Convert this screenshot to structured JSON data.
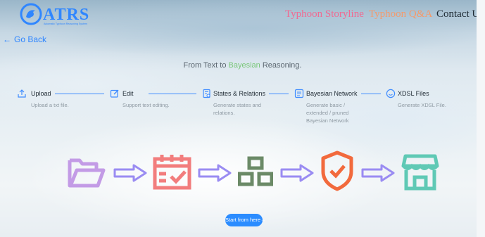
{
  "header": {
    "logo_text": "ATRS",
    "logo_subtitle": "Automatic Typhoon Reasoning System",
    "nav": {
      "storyline": "Typhoon Storyline",
      "qa": "Typhoon Q&A",
      "contact": "Contact Us"
    }
  },
  "go_back": "Go Back",
  "headline": {
    "prefix": "From Text to ",
    "highlight": "Bayesian",
    "suffix": " Reasoning."
  },
  "steps": [
    {
      "title": "Upload",
      "desc": "Upload a txt file.",
      "icon": "upload-icon"
    },
    {
      "title": "Edit",
      "desc": "Support text editing.",
      "icon": "edit-icon"
    },
    {
      "title": "States & Relations",
      "desc": "Generate states and relations.",
      "icon": "document-search-icon"
    },
    {
      "title": "Bayesian Network",
      "desc": "Generate basic / extended / pruned Bayesian Network",
      "icon": "list-icon"
    },
    {
      "title": "XDSL Files",
      "desc": "Generate XDSL File.",
      "icon": "smile-icon"
    }
  ],
  "flow_icons": [
    "folder-icon",
    "calendar-check-icon",
    "blocks-icon",
    "shield-check-icon",
    "store-icon"
  ],
  "start_button": "Start from here→",
  "colors": {
    "accent_blue": "#2b8cff",
    "storyline_pink": "#f06a92",
    "qa_orange": "#f49a6c",
    "highlight_green": "#7ac77a",
    "folder_purple": "#c39be6",
    "calendar_red": "#f27d7d",
    "blocks_green": "#6b8a67",
    "shield_orange": "#f26a3d",
    "store_teal": "#5fc9b5",
    "arrow_purple": "#9a8cf2"
  }
}
